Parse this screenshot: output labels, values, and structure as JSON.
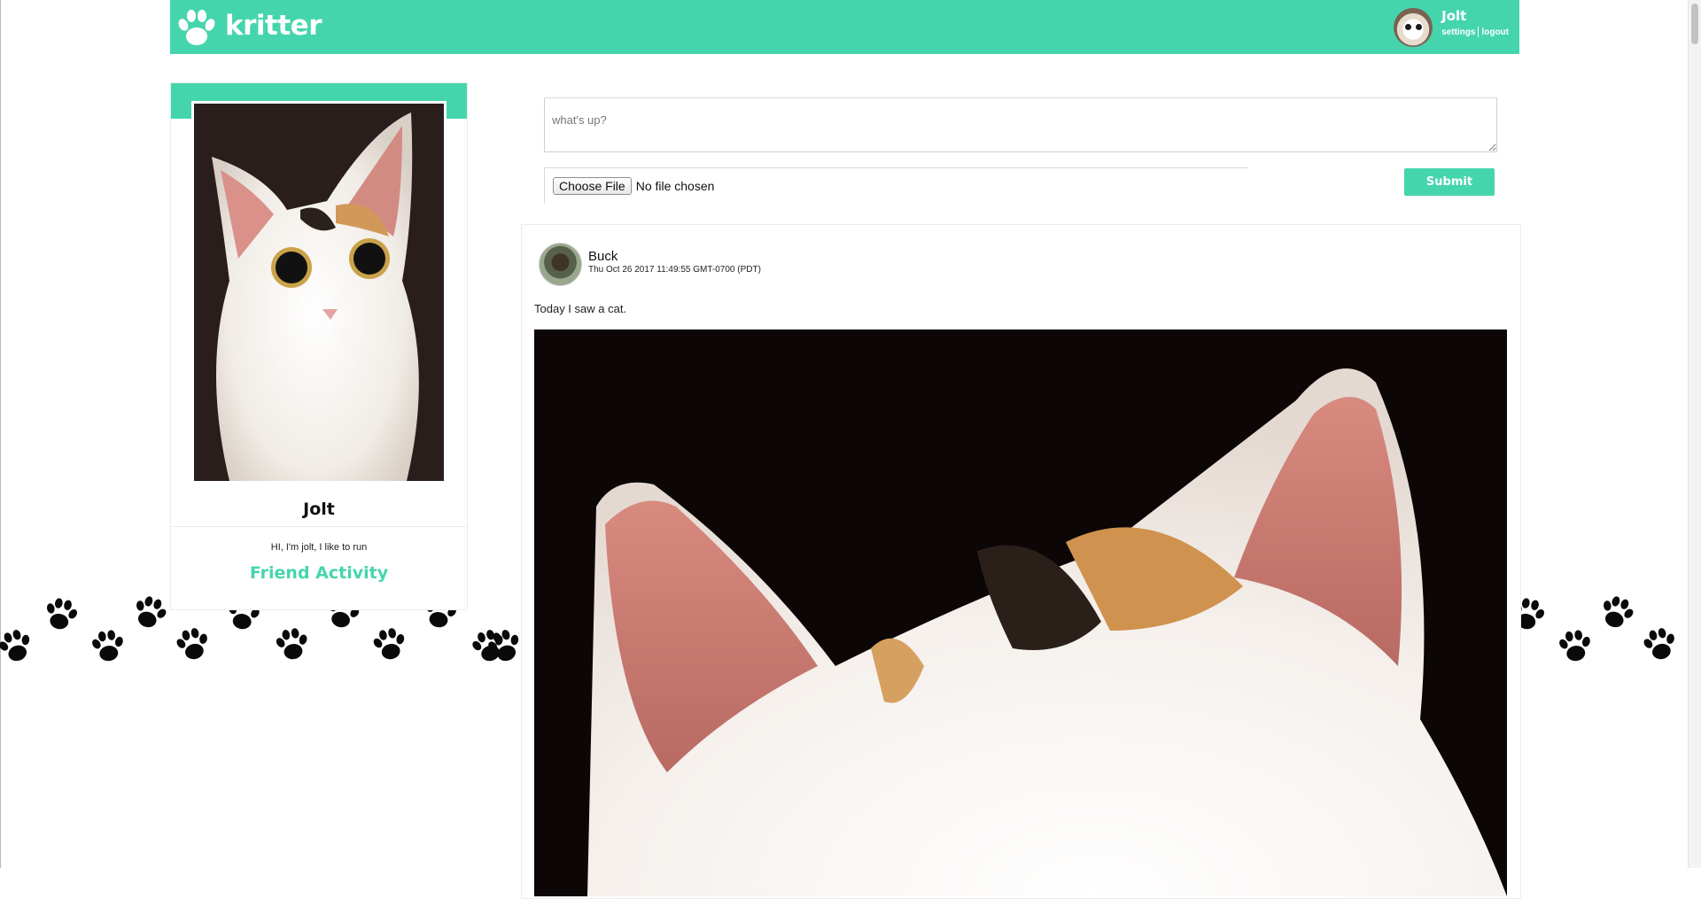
{
  "header": {
    "logo_text": "kritter",
    "user": {
      "name": "Jolt",
      "settings_label": "settings",
      "logout_label": "logout"
    }
  },
  "profile": {
    "name": "Jolt",
    "bio": "HI, I'm jolt, I like to run",
    "friend_activity_label": "Friend Activity"
  },
  "composer": {
    "placeholder": "what's up?",
    "choose_file_label": "Choose File",
    "file_status": "No file chosen",
    "submit_label": "Submit"
  },
  "posts": [
    {
      "author": "Buck",
      "timestamp": "Thu Oct 26 2017 11:49:55 GMT-0700 (PDT)",
      "text": "Today I saw a cat."
    }
  ],
  "colors": {
    "brand": "#45d5ad",
    "text": "#222222"
  },
  "icons": {
    "logo": "paw-icon",
    "background_pattern": "paw-print-icon"
  }
}
